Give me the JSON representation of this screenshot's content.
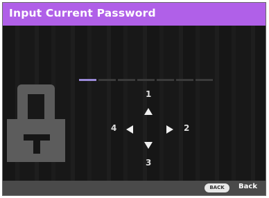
{
  "window": {
    "title": "Input Current Password"
  },
  "password": {
    "total_digits": 7,
    "entered_digits": 1
  },
  "keypad": {
    "up": "1",
    "right": "2",
    "down": "3",
    "left": "4"
  },
  "footer": {
    "back_key": "BACK",
    "back_label": "Back"
  },
  "colors": {
    "title_bar": "#b060e8",
    "background": "#141414",
    "footer_bar": "#4a4a4a",
    "active_digit": "#9a8ad8"
  },
  "icons": {
    "lock": "lock-icon",
    "up": "arrow-up-icon",
    "right": "arrow-right-icon",
    "down": "arrow-down-icon",
    "left": "arrow-left-icon"
  }
}
